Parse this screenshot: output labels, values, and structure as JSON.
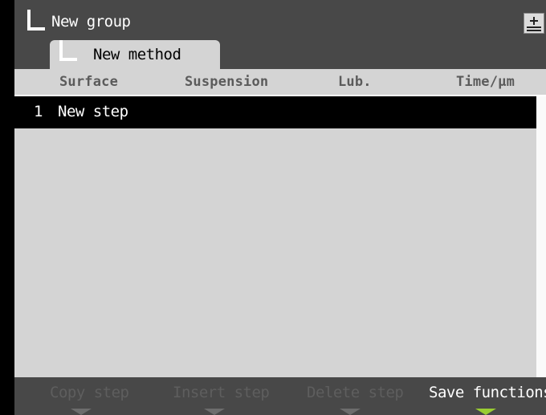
{
  "header": {
    "group_title": "New group",
    "method_tab": "New method",
    "save_icon": "save-icon"
  },
  "table": {
    "columns": [
      "Surface",
      "Suspension",
      "Lub.",
      "Time/µm"
    ],
    "rows": [
      {
        "number": "1",
        "name": "New step"
      }
    ]
  },
  "softkeys": [
    {
      "label": "Copy step",
      "enabled": false
    },
    {
      "label": "Insert step",
      "enabled": false
    },
    {
      "label": "Delete step",
      "enabled": false
    },
    {
      "label": "Save functions",
      "enabled": true
    }
  ],
  "colors": {
    "background": "#484848",
    "panel": "#d4d4d4",
    "selected_row": "#000000",
    "active_arrow": "#9acd32"
  }
}
